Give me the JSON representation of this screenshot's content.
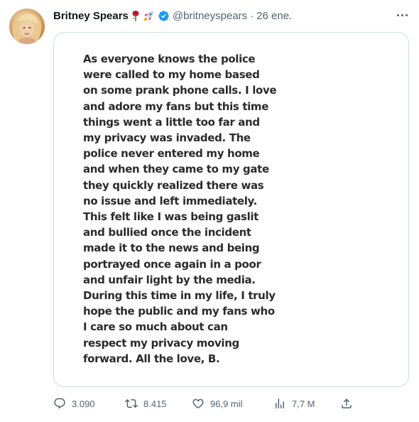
{
  "tweet": {
    "author_name": "Britney Spears",
    "name_emojis": [
      "rose-emoji",
      "rocket-emoji"
    ],
    "verified": true,
    "handle": "@britneyspears",
    "separator": "·",
    "date": "26 ene.",
    "statement_text": "As everyone knows the police\nwere called to my home based\non some prank phone calls. I love\nand adore my fans but this time\nthings went a little too far and\nmy privacy was invaded. The\npolice never entered my home\nand when they came to my gate\nthey quickly realized there was\nno issue and left immediately.\nThis felt like I was being gaslit\nand bullied once the incident\nmade it to the news and being\nportrayed once again in a poor\nand unfair light by the media.\nDuring this time in my life, I truly\nhope the public and my fans who\nI care so much about can\nrespect my privacy moving\nforward. All the love, B.",
    "actions": {
      "replies": "3.090",
      "retweets": "8.415",
      "likes": "96,9 mil",
      "views": "7,7 M"
    },
    "icons": {
      "reply": "reply-icon",
      "retweet": "retweet-icon",
      "like": "heart-icon",
      "views": "views-icon",
      "share": "share-icon",
      "more": "more-icon",
      "verified": "verified-badge-icon"
    },
    "colors": {
      "verified_blue": "#1d9bf0",
      "text_secondary": "#536471",
      "card_border": "#cfd9de"
    }
  }
}
